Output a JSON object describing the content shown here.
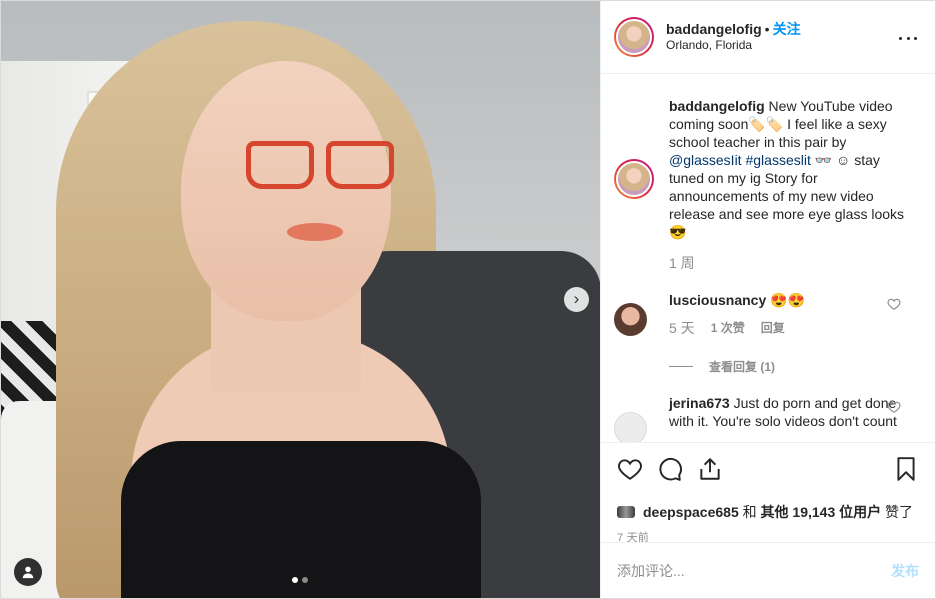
{
  "post": {
    "media": {
      "dots": 2,
      "active_dot": 0,
      "next_icon": "chevron-right-icon",
      "user_tag_icon": "person-icon"
    },
    "header": {
      "username": "baddangelofig",
      "separator": "•",
      "follow_label": "关注",
      "location": "Orlando, Florida",
      "more_icon": "more-horizontal-icon"
    },
    "caption": {
      "username": "baddangelofig",
      "text_1": " New YouTube video coming soon🏷️🏷️ I feel like a sexy school teacher in this pair by ",
      "mention": "@glassesIit",
      "space": " ",
      "hashtag": "#glasseslit",
      "text_2": " 👓 ☺ stay tuned on my ig Story for announcements of my new video release and see more eye glass looks 😎",
      "time": "1 周"
    },
    "comments": [
      {
        "username": "lusciousnancy",
        "text": " 😍😍",
        "time": "5 天",
        "likes": "1 次赞",
        "reply_label": "回复",
        "view_replies": "查看回复 (1)"
      },
      {
        "username": "jerina673",
        "text": " Just do porn and get done with it. You're solo videos don't count"
      }
    ],
    "actions": {
      "like_icon": "heart-icon",
      "comment_icon": "comment-icon",
      "share_icon": "share-icon",
      "save_icon": "bookmark-icon"
    },
    "likes": {
      "liker": "deepspace685",
      "and_label": " 和 ",
      "others_label": "其他",
      "count": " 19,143 ",
      "users_label": "位用户",
      "suffix": " 赞了"
    },
    "time_ago": "7 天前",
    "add_comment": {
      "placeholder": "添加评论...",
      "post_label": "发布"
    }
  },
  "colors": {
    "accent_blue": "#0095f6",
    "post_disabled": "#b2dffc",
    "muted": "#8e8e8e"
  }
}
